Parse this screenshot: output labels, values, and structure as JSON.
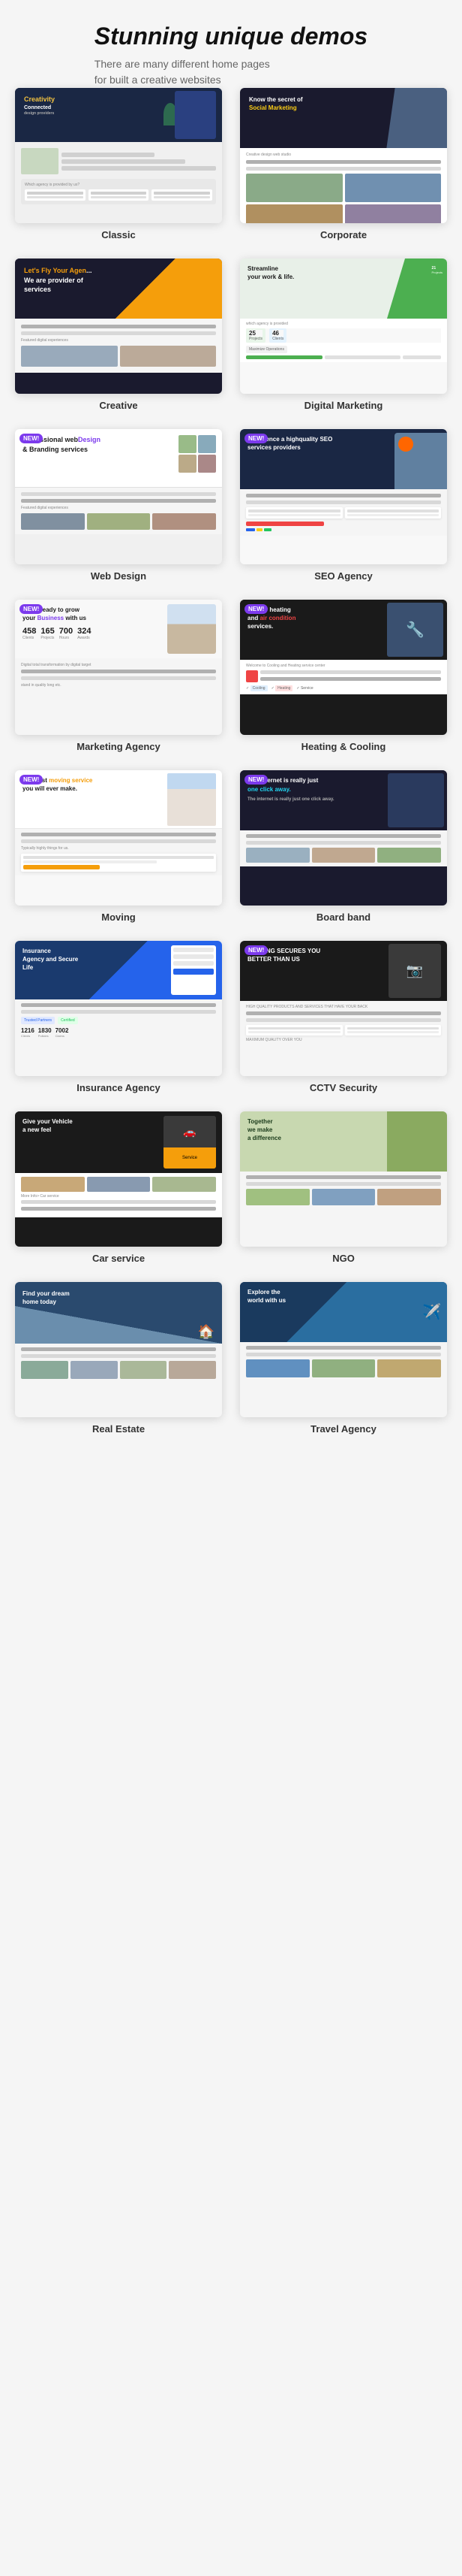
{
  "header": {
    "title": "Stunning unique demos",
    "subtitle": "There are many different home pages\nfor built a creative websites"
  },
  "demos": [
    {
      "id": "classic",
      "label": "Classic",
      "new": false
    },
    {
      "id": "corporate",
      "label": "Corporate",
      "new": false
    },
    {
      "id": "creative",
      "label": "Creative",
      "new": false
    },
    {
      "id": "digital-marketing",
      "label": "Digital Marketing",
      "new": false
    },
    {
      "id": "web-design",
      "label": "Web Design",
      "new": true
    },
    {
      "id": "seo-agency",
      "label": "SEO Agency",
      "new": true
    },
    {
      "id": "marketing-agency",
      "label": "Marketing Agency",
      "new": true
    },
    {
      "id": "heating-cooling",
      "label": "Heating & Cooling",
      "new": true
    },
    {
      "id": "moving",
      "label": "Moving",
      "new": true
    },
    {
      "id": "board-band",
      "label": "Board band",
      "new": true
    },
    {
      "id": "insurance-agency",
      "label": "Insurance Agency",
      "new": false
    },
    {
      "id": "cctv-security",
      "label": "CCTV Security",
      "new": true
    },
    {
      "id": "car-service",
      "label": "Car service",
      "new": false
    },
    {
      "id": "ngo",
      "label": "NGO",
      "new": false
    },
    {
      "id": "real-estate",
      "label": "Real Estate",
      "new": false
    },
    {
      "id": "travel-agency",
      "label": "Travel Agency",
      "new": false
    }
  ]
}
